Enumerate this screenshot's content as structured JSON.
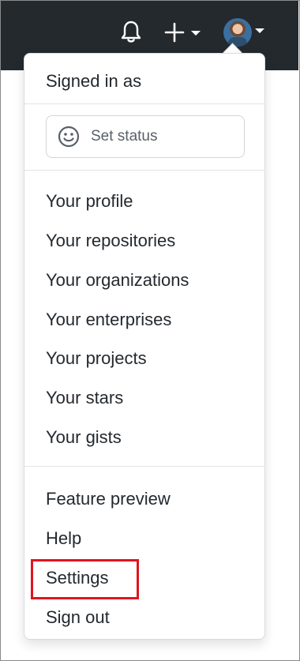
{
  "topbar": {
    "icons": [
      "bell-icon",
      "plus-icon",
      "chevron-down-icon",
      "avatar",
      "chevron-down-icon"
    ]
  },
  "dropdown": {
    "signed_in_label": "Signed in as",
    "status_button": "Set status",
    "profile_items": [
      "Your profile",
      "Your repositories",
      "Your organizations",
      "Your enterprises",
      "Your projects",
      "Your stars",
      "Your gists"
    ],
    "footer_items": [
      "Feature preview",
      "Help",
      "Settings",
      "Sign out"
    ]
  },
  "highlight": {
    "target": "Settings",
    "color": "#e0141e"
  }
}
